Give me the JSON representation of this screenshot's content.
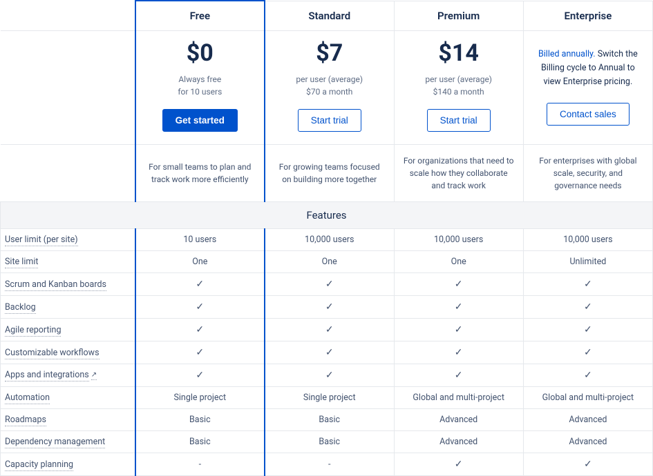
{
  "plans": {
    "free": {
      "name": "Free",
      "price": "$0",
      "sub1": "Always free",
      "sub2": "for 10 users",
      "cta": "Get started"
    },
    "standard": {
      "name": "Standard",
      "price": "$7",
      "sub1": "per user (average)",
      "sub2": "$70 a month",
      "cta": "Start trial"
    },
    "premium": {
      "name": "Premium",
      "price": "$14",
      "sub1": "per user (average)",
      "sub2": "$140 a month",
      "cta": "Start trial"
    },
    "enterprise": {
      "name": "Enterprise",
      "note_link": "Billed annually.",
      "note_rest": " Switch the Billing cycle to Annual to view Enterprise pricing.",
      "cta": "Contact sales"
    }
  },
  "descriptions": {
    "free": "For small teams to plan and track work more efficiently",
    "standard": "For growing teams focused on building more together",
    "premium": "For organizations that need to scale how they collaborate and track work",
    "enterprise": "For enterprises with global scale, security, and governance needs"
  },
  "features_header": "Features",
  "feature_rows": [
    {
      "label": "User limit (per site)",
      "free": "10 users",
      "standard": "10,000 users",
      "premium": "10,000 users",
      "enterprise": "10,000 users"
    },
    {
      "label": "Site limit",
      "free": "One",
      "standard": "One",
      "premium": "One",
      "enterprise": "Unlimited"
    },
    {
      "label": "Scrum and Kanban boards",
      "free": "✓",
      "standard": "✓",
      "premium": "✓",
      "enterprise": "✓"
    },
    {
      "label": "Backlog",
      "free": "✓",
      "standard": "✓",
      "premium": "✓",
      "enterprise": "✓"
    },
    {
      "label": "Agile reporting",
      "free": "✓",
      "standard": "✓",
      "premium": "✓",
      "enterprise": "✓"
    },
    {
      "label": "Customizable workflows",
      "free": "✓",
      "standard": "✓",
      "premium": "✓",
      "enterprise": "✓"
    },
    {
      "label": "Apps and integrations",
      "free": "✓",
      "standard": "✓",
      "premium": "✓",
      "enterprise": "✓",
      "external": true
    },
    {
      "label": "Automation",
      "free": "Single project",
      "standard": "Single project",
      "premium": "Global and multi-project",
      "enterprise": "Global and multi-project"
    },
    {
      "label": "Roadmaps",
      "free": "Basic",
      "standard": "Basic",
      "premium": "Advanced",
      "enterprise": "Advanced"
    },
    {
      "label": "Dependency management",
      "free": "Basic",
      "standard": "Basic",
      "premium": "Advanced",
      "enterprise": "Advanced"
    },
    {
      "label": "Capacity planning",
      "free": "-",
      "standard": "-",
      "premium": "✓",
      "enterprise": "✓"
    }
  ]
}
